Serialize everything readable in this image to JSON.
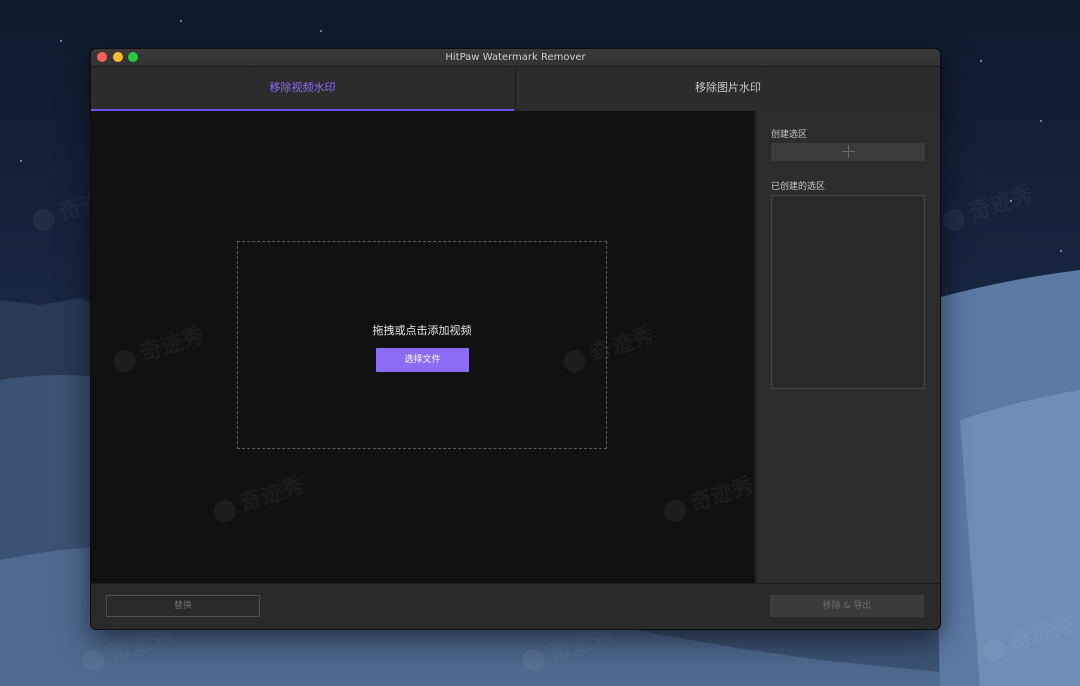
{
  "window": {
    "title": "HitPaw Watermark Remover"
  },
  "tabs": [
    {
      "label": "移除视频水印",
      "active": true
    },
    {
      "label": "移除图片水印",
      "active": false
    }
  ],
  "main": {
    "drop_text": "拖拽或点击添加视频",
    "choose_button": "选择文件"
  },
  "sidebar": {
    "create_label": "创建选区",
    "created_label": "已创建的选区",
    "add_icon": "plus-icon"
  },
  "bottom": {
    "replace_button": "替换",
    "export_button": "移除 & 导出"
  },
  "watermark_text": "奇迹秀",
  "colors": {
    "accent": "#8a6cf7",
    "active_tab": "#8f6cf5",
    "close": "#fe5f57",
    "minimize": "#febc2e",
    "maximize": "#28c840"
  }
}
